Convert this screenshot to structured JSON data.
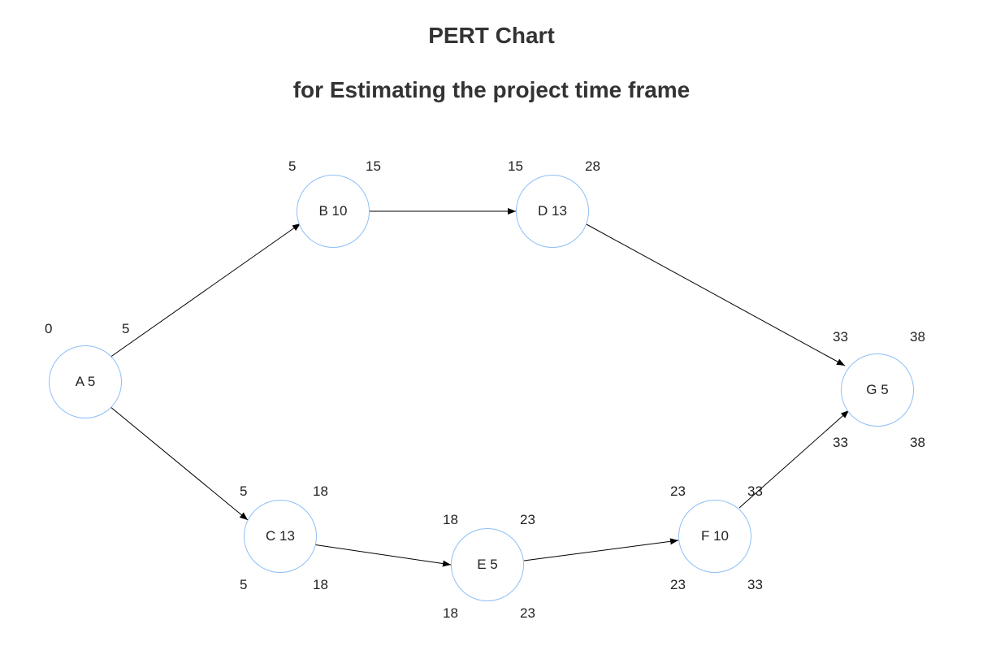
{
  "title_line1": "PERT Chart",
  "title_line2": "for Estimating the project time frame",
  "nodes": {
    "A": {
      "label": "A 5",
      "es": "0",
      "ef": "5"
    },
    "B": {
      "label": "B 10",
      "es": "5",
      "ef": "15"
    },
    "C": {
      "label": "C 13",
      "es": "5",
      "ef": "18",
      "ls": "5",
      "lf": "18"
    },
    "D": {
      "label": "D 13",
      "es": "15",
      "ef": "28"
    },
    "E": {
      "label": "E 5",
      "es": "18",
      "ef": "23",
      "ls": "18",
      "lf": "23"
    },
    "F": {
      "label": "F 10",
      "es": "23",
      "ef": "33",
      "ls": "23",
      "lf": "33"
    },
    "G": {
      "label": "G 5",
      "es": "33",
      "ef": "38",
      "ls": "33",
      "lf": "38"
    }
  },
  "edges": [
    {
      "from": "A",
      "to": "B"
    },
    {
      "from": "A",
      "to": "C"
    },
    {
      "from": "B",
      "to": "D"
    },
    {
      "from": "C",
      "to": "E"
    },
    {
      "from": "E",
      "to": "F"
    },
    {
      "from": "D",
      "to": "G"
    },
    {
      "from": "F",
      "to": "G"
    }
  ],
  "chart_data": {
    "type": "pert",
    "activities": [
      {
        "id": "A",
        "duration": 5,
        "es": 0,
        "ef": 5,
        "predecessors": []
      },
      {
        "id": "B",
        "duration": 10,
        "es": 5,
        "ef": 15,
        "predecessors": [
          "A"
        ]
      },
      {
        "id": "C",
        "duration": 13,
        "es": 5,
        "ef": 18,
        "ls": 5,
        "lf": 18,
        "predecessors": [
          "A"
        ]
      },
      {
        "id": "D",
        "duration": 13,
        "es": 15,
        "ef": 28,
        "predecessors": [
          "B"
        ]
      },
      {
        "id": "E",
        "duration": 5,
        "es": 18,
        "ef": 23,
        "ls": 18,
        "lf": 23,
        "predecessors": [
          "C"
        ]
      },
      {
        "id": "F",
        "duration": 10,
        "es": 23,
        "ef": 33,
        "ls": 23,
        "lf": 33,
        "predecessors": [
          "E"
        ]
      },
      {
        "id": "G",
        "duration": 5,
        "es": 33,
        "ef": 38,
        "ls": 33,
        "lf": 38,
        "predecessors": [
          "D",
          "F"
        ]
      }
    ],
    "project_duration": 38
  }
}
